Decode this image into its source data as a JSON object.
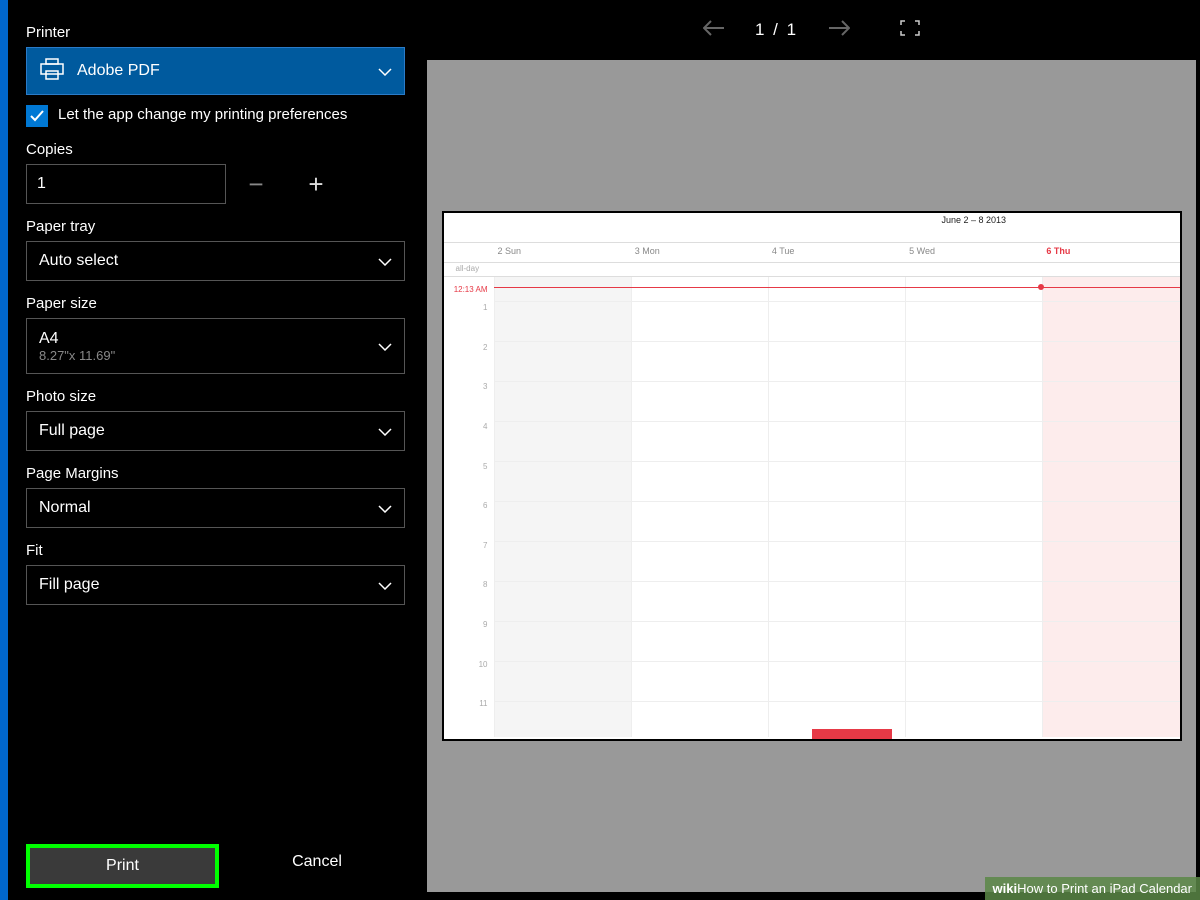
{
  "panel": {
    "printer_label": "Printer",
    "printer_selected": "Adobe PDF",
    "checkbox_label": "Let the app change my printing preferences",
    "copies_label": "Copies",
    "copies_value": "1",
    "paper_tray_label": "Paper tray",
    "paper_tray_value": "Auto select",
    "paper_size_label": "Paper size",
    "paper_size_value": "A4",
    "paper_size_sub": "8.27\"x 11.69\"",
    "photo_size_label": "Photo size",
    "photo_size_value": "Full page",
    "page_margins_label": "Page Margins",
    "page_margins_value": "Normal",
    "fit_label": "Fit",
    "fit_value": "Fill page",
    "print_button": "Print",
    "cancel_button": "Cancel"
  },
  "preview": {
    "page_current": "1",
    "page_separator": " / ",
    "page_total": "1"
  },
  "calendar": {
    "title": "June 2 – 8 2013",
    "allday_label": "all-day",
    "now_time": "12:13 AM",
    "days": [
      {
        "label": "2 Sun"
      },
      {
        "label": "3 Mon"
      },
      {
        "label": "4 Tue"
      },
      {
        "label": "5 Wed"
      },
      {
        "label": "6 Thu"
      }
    ],
    "hours": [
      "1",
      "2",
      "3",
      "4",
      "5",
      "6",
      "7",
      "8",
      "9",
      "10",
      "11"
    ]
  },
  "watermark": {
    "brand_bold": "wiki",
    "brand_rest": "How",
    "text": " to Print an iPad Calendar"
  }
}
